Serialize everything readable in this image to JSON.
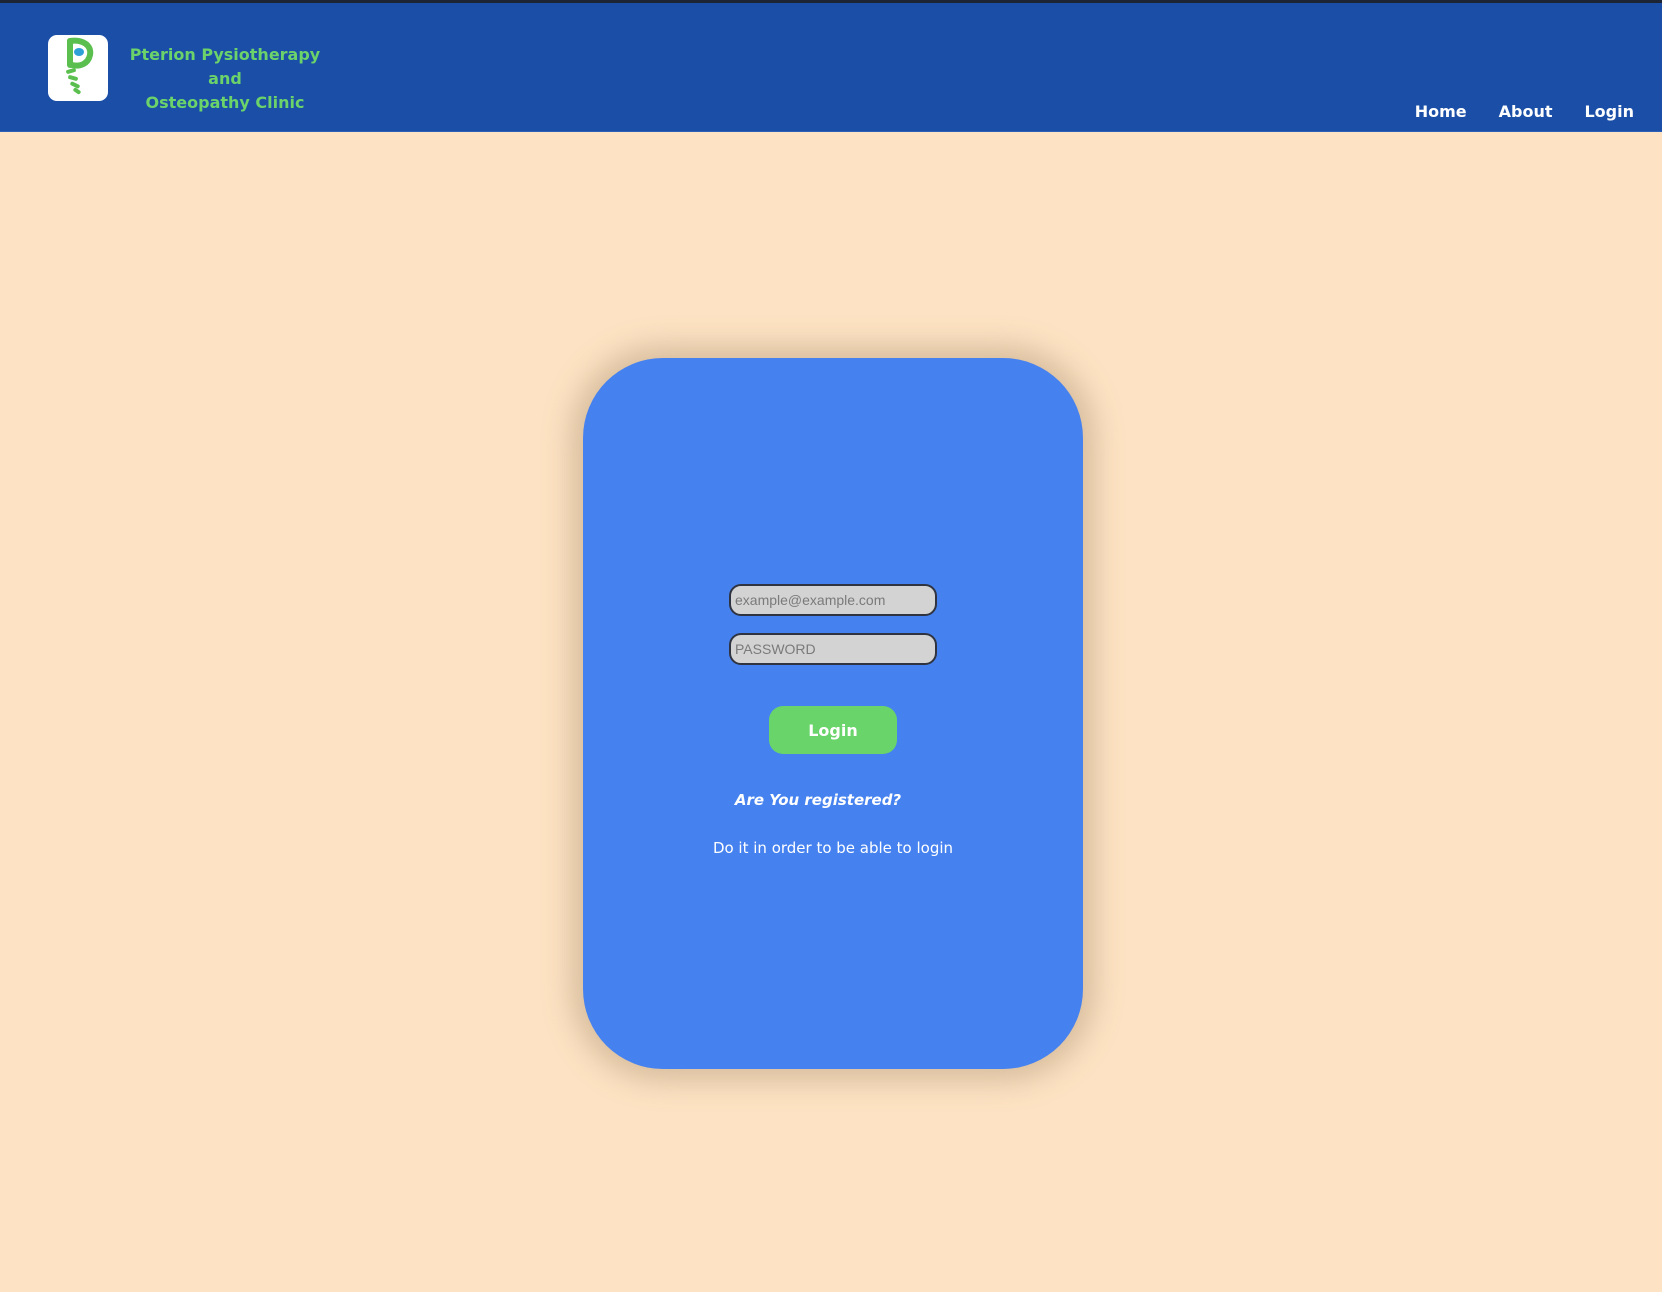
{
  "brand": {
    "line1": "Pterion Pysiotherapy and",
    "line2": "Osteopathy Clinic",
    "logo_icon": "spine-logo-icon"
  },
  "nav": {
    "items": [
      {
        "label": "Home"
      },
      {
        "label": "About"
      },
      {
        "label": "Login"
      }
    ]
  },
  "login_form": {
    "email_placeholder": "example@example.com",
    "email_value": "",
    "password_placeholder": "PASSWORD",
    "password_value": "",
    "submit_label": "Login",
    "register_question": "Are You registered?",
    "register_hint": "Do it in order to be able to login"
  },
  "colors": {
    "header_bg": "#1a4ea7",
    "page_bg": "#fde3c3",
    "card_bg": "#4582ef",
    "brand_green": "#6bd36a",
    "button_green": "#68d469"
  }
}
